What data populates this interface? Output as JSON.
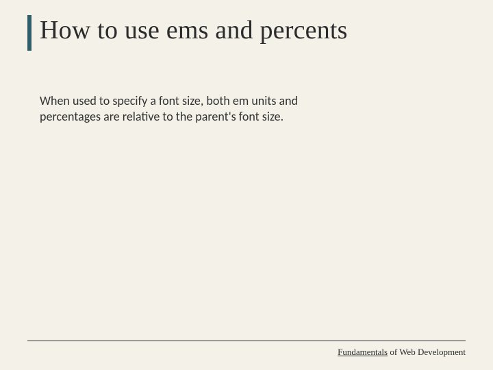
{
  "slide": {
    "title": "How to use ems and percents",
    "body": "When used to specify a font size, both em units and percentages are relative to the parent's font size."
  },
  "footer": {
    "first_word": "Fundamentals",
    "rest": " of Web Development"
  }
}
